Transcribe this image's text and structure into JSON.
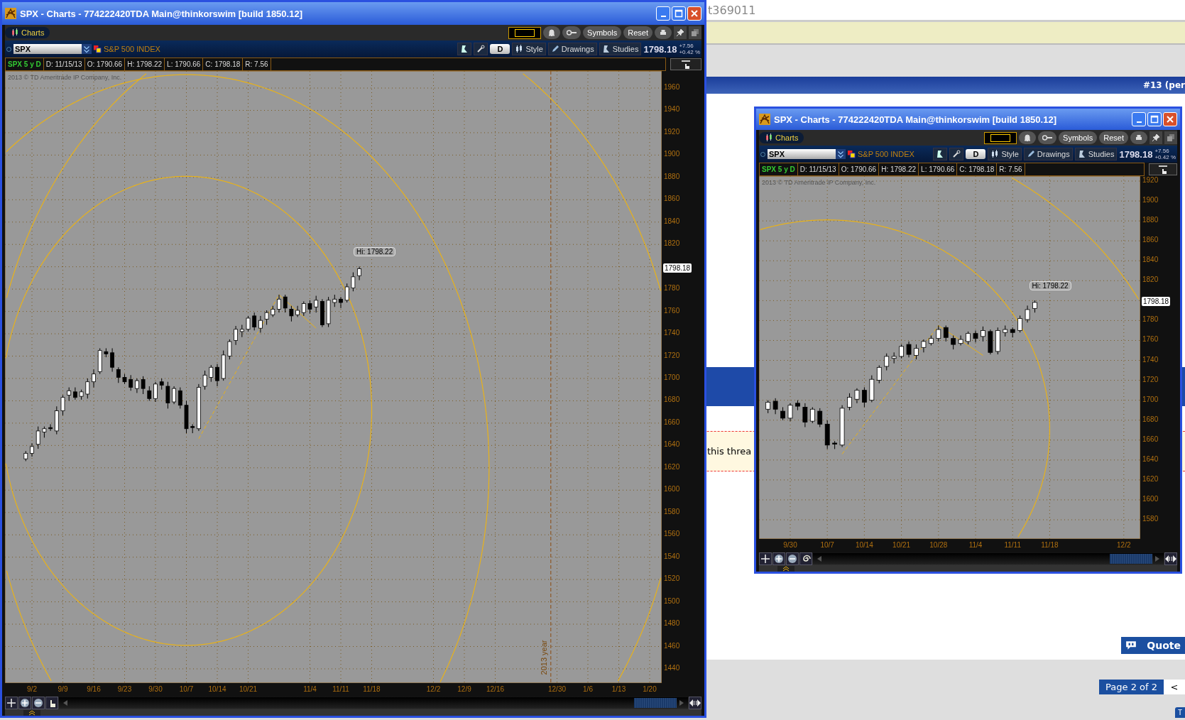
{
  "browser_page": {
    "url_fragment": "t369011",
    "post_header": "#13 (per",
    "notice_text": "this threa",
    "quote_button": "Quote",
    "pagination": {
      "label": "Page 2 of 2",
      "prev": "<"
    },
    "corner_button": "T"
  },
  "chart_windows": [
    {
      "title": "SPX - Charts - 774222420TDA Main@thinkorswim [build 1850.12]",
      "tab": "Charts",
      "buttons": [
        "Symbols",
        "Reset"
      ],
      "symbol": "SPX",
      "description": "S&P 500 INDEX",
      "aggregation": "D",
      "toolbar": [
        "Style",
        "Drawings",
        "Studies"
      ],
      "last": "1798.18",
      "change": "+7.56",
      "change_pct": "+0.42 %",
      "study": "SPX 5 y D",
      "info": [
        "D: 11/15/13",
        "O: 1790.66",
        "H: 1798.22",
        "L: 1790.66",
        "C: 1798.18",
        "R: 7.56"
      ],
      "copyright": "2013 © TD Ameritrade IP Company, Inc.",
      "price_tag": "1798.18",
      "high_label": "Hi: 1798.22",
      "period_label": "2013 year",
      "y_labels": [
        "1960",
        "1940",
        "1920",
        "1900",
        "1880",
        "1860",
        "1840",
        "1820",
        "1780",
        "1760",
        "1740",
        "1720",
        "1700",
        "1680",
        "1660",
        "1640",
        "1620",
        "1600",
        "1580",
        "1560",
        "1540",
        "1520",
        "1500",
        "1480",
        "1460",
        "1440"
      ],
      "x_labels": [
        "9/2",
        "9/9",
        "9/16",
        "9/23",
        "9/30",
        "10/7",
        "10/14",
        "10/21",
        "11/4",
        "11/11",
        "11/18",
        "12/2",
        "12/9",
        "12/16",
        "12/30",
        "1/6",
        "1/13",
        "1/20"
      ]
    },
    {
      "title": "SPX - Charts - 774222420TDA Main@thinkorswim [build 1850.12]",
      "tab": "Charts",
      "buttons": [
        "Symbols",
        "Reset"
      ],
      "symbol": "SPX",
      "description": "S&P 500 INDEX",
      "aggregation": "D",
      "toolbar": [
        "Style",
        "Drawings",
        "Studies"
      ],
      "last": "1798.18",
      "change": "+7.56",
      "change_pct": "+0.42 %",
      "study": "SPX 5 y D",
      "info": [
        "D: 11/15/13",
        "O: 1790.66",
        "H: 1798.22",
        "L: 1790.66",
        "C: 1798.18",
        "R: 7.56"
      ],
      "copyright": "2013 © TD Ameritrade IP Company, Inc.",
      "price_tag": "1798.18",
      "high_label": "Hi: 1798.22",
      "y_labels": [
        "1920",
        "1900",
        "1880",
        "1860",
        "1840",
        "1820",
        "1780",
        "1760",
        "1740",
        "1720",
        "1700",
        "1680",
        "1660",
        "1640",
        "1620",
        "1600",
        "1580"
      ],
      "x_labels": [
        "9/30",
        "10/7",
        "10/14",
        "10/21",
        "10/28",
        "11/4",
        "11/11",
        "11/18",
        "12/2"
      ]
    }
  ]
}
